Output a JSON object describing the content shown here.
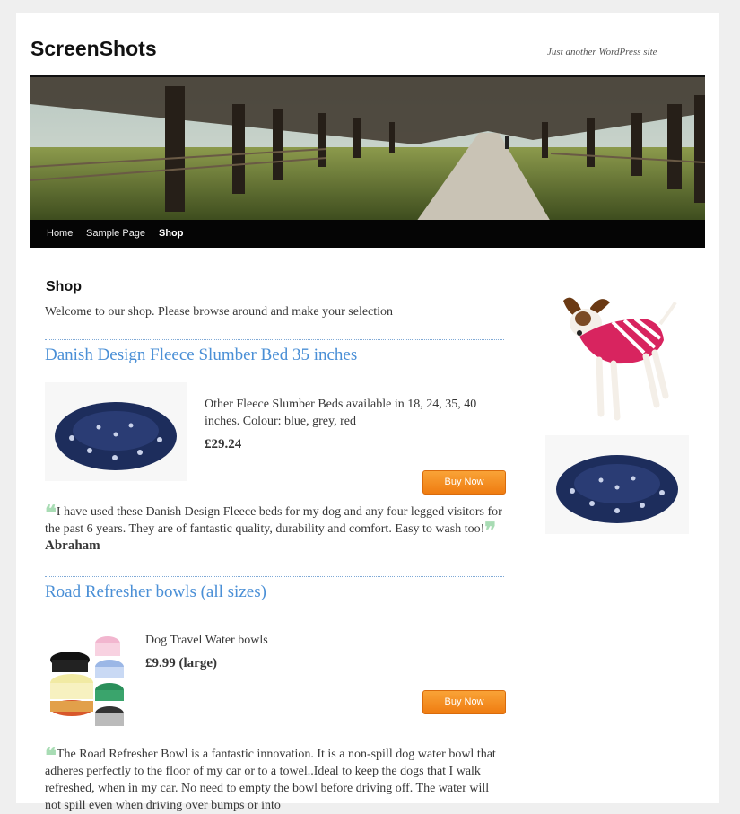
{
  "site": {
    "title": "ScreenShots",
    "description": "Just another WordPress site"
  },
  "nav": {
    "items": [
      {
        "label": "Home",
        "active": false
      },
      {
        "label": "Sample Page",
        "active": false
      },
      {
        "label": "Shop",
        "active": true
      }
    ]
  },
  "main": {
    "page_title": "Shop",
    "intro": "Welcome to our shop. Please browse around and make your selection",
    "products": [
      {
        "title": "Danish Design Fleece Slumber Bed 35 inches",
        "description": "Other Fleece Slumber Beds available in 18, 24, 35, 40 inches. Colour: blue, grey, red",
        "price": "£29.24",
        "buy_label": "Buy Now",
        "testimonial": "I have used these Danish Design Fleece beds for my dog and any four legged visitors for the past 6 years. They are of fantastic quality, durability and comfort. Easy to wash too!",
        "author": "Abraham"
      },
      {
        "title": "Road Refresher bowls (all sizes)",
        "description": "Dog Travel Water bowls",
        "price": "£9.99 (large)",
        "buy_label": "Buy Now",
        "testimonial": "The Road Refresher Bowl is a fantastic innovation. It is a non-spill dog water bowl that adheres perfectly to the floor of my car or to a towel..Ideal to keep the dogs that I walk refreshed, when in my car. No need to empty the bowl before driving off.  The water will not spill even when driving over bumps or into"
      }
    ]
  },
  "colors": {
    "link": "#4a8fd6",
    "button": "#f39426",
    "nav_bg": "#050505",
    "quote": "#a8dcb4"
  }
}
